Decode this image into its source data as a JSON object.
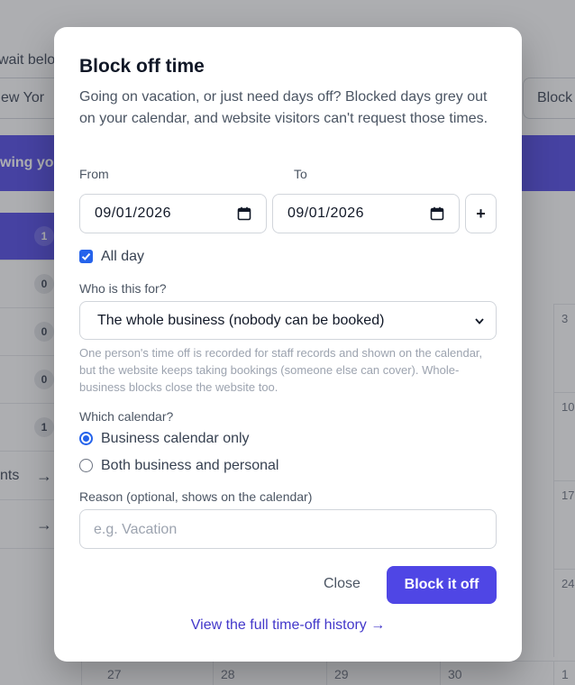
{
  "background": {
    "wait_text": "wait belo",
    "timezone_value": "ew Yor",
    "block_button": "Block",
    "banner_text": "wing you",
    "list_badges": [
      "1",
      "0",
      "0",
      "0",
      "1"
    ],
    "links": [
      {
        "label": "nts",
        "arrow": "→"
      },
      {
        "label": "",
        "arrow": "→"
      }
    ],
    "calendar_right_dates": [
      "3",
      "10",
      "17",
      "24"
    ],
    "calendar_bottom_dates": [
      "27",
      "28",
      "29",
      "30",
      "1"
    ]
  },
  "modal": {
    "title": "Block off time",
    "description": "Going on vacation, or just need days off? Blocked days grey out on your calendar, and website visitors can't request those times.",
    "from_label": "From",
    "to_label": "To",
    "from_value": "09/01/2026",
    "to_value": "09/01/2026",
    "add_range_symbol": "+",
    "all_day": {
      "label": "All day",
      "checked": true
    },
    "who_label": "Who is this for?",
    "who_selected": "The whole business (nobody can be booked)",
    "who_hint": "One person's time off is recorded for staff records and shown on the calendar, but the website keeps taking bookings (someone else can cover). Whole-business blocks close the website too.",
    "calendar_label": "Which calendar?",
    "calendar_options": [
      {
        "label": "Business calendar only",
        "selected": true
      },
      {
        "label": "Both business and personal",
        "selected": false
      }
    ],
    "reason_label": "Reason (optional, shows on the calendar)",
    "reason_placeholder": "e.g. Vacation",
    "close_label": "Close",
    "submit_label": "Block it off",
    "history_link": "View the full time-off history →"
  },
  "colors": {
    "accent": "#4f46e5",
    "checkbox": "#2563eb",
    "link": "#4338ca"
  }
}
